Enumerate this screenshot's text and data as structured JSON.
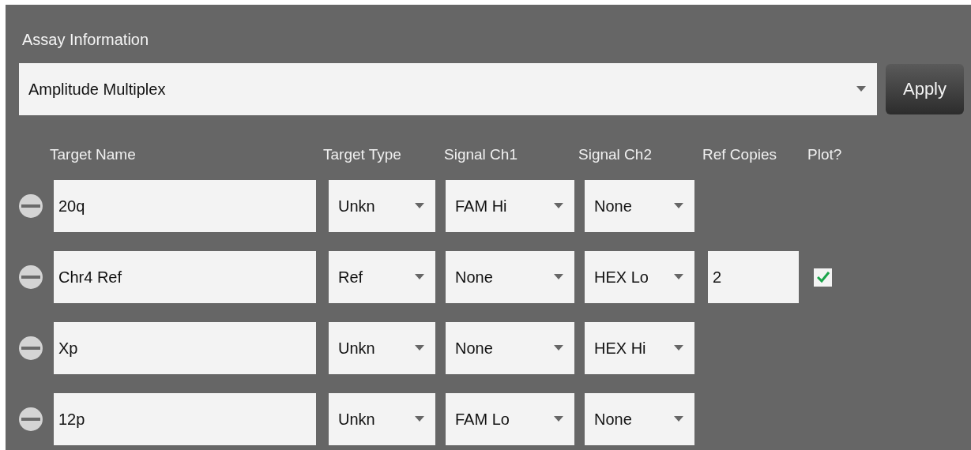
{
  "section": {
    "title": "Assay Information"
  },
  "assay_select": {
    "value": "Amplitude Multiplex"
  },
  "apply_button": "Apply",
  "table": {
    "columns": [
      "Target Name",
      "Target Type",
      "Signal Ch1",
      "Signal Ch2",
      "Ref Copies",
      "Plot?"
    ],
    "rows": [
      {
        "name": "20q",
        "target_type": "Unkn",
        "signal_ch1": "FAM Hi",
        "signal_ch2": "None"
      },
      {
        "name": "Chr4 Ref",
        "target_type": "Ref",
        "signal_ch1": "None",
        "signal_ch2": "HEX Lo",
        "ref_copies": "2",
        "plot": {
          "checked": true
        }
      },
      {
        "name": "Xp",
        "target_type": "Unkn",
        "signal_ch1": "None",
        "signal_ch2": "HEX Hi"
      },
      {
        "name": "12p",
        "target_type": "Unkn",
        "signal_ch1": "FAM Lo",
        "signal_ch2": "None"
      }
    ]
  }
}
